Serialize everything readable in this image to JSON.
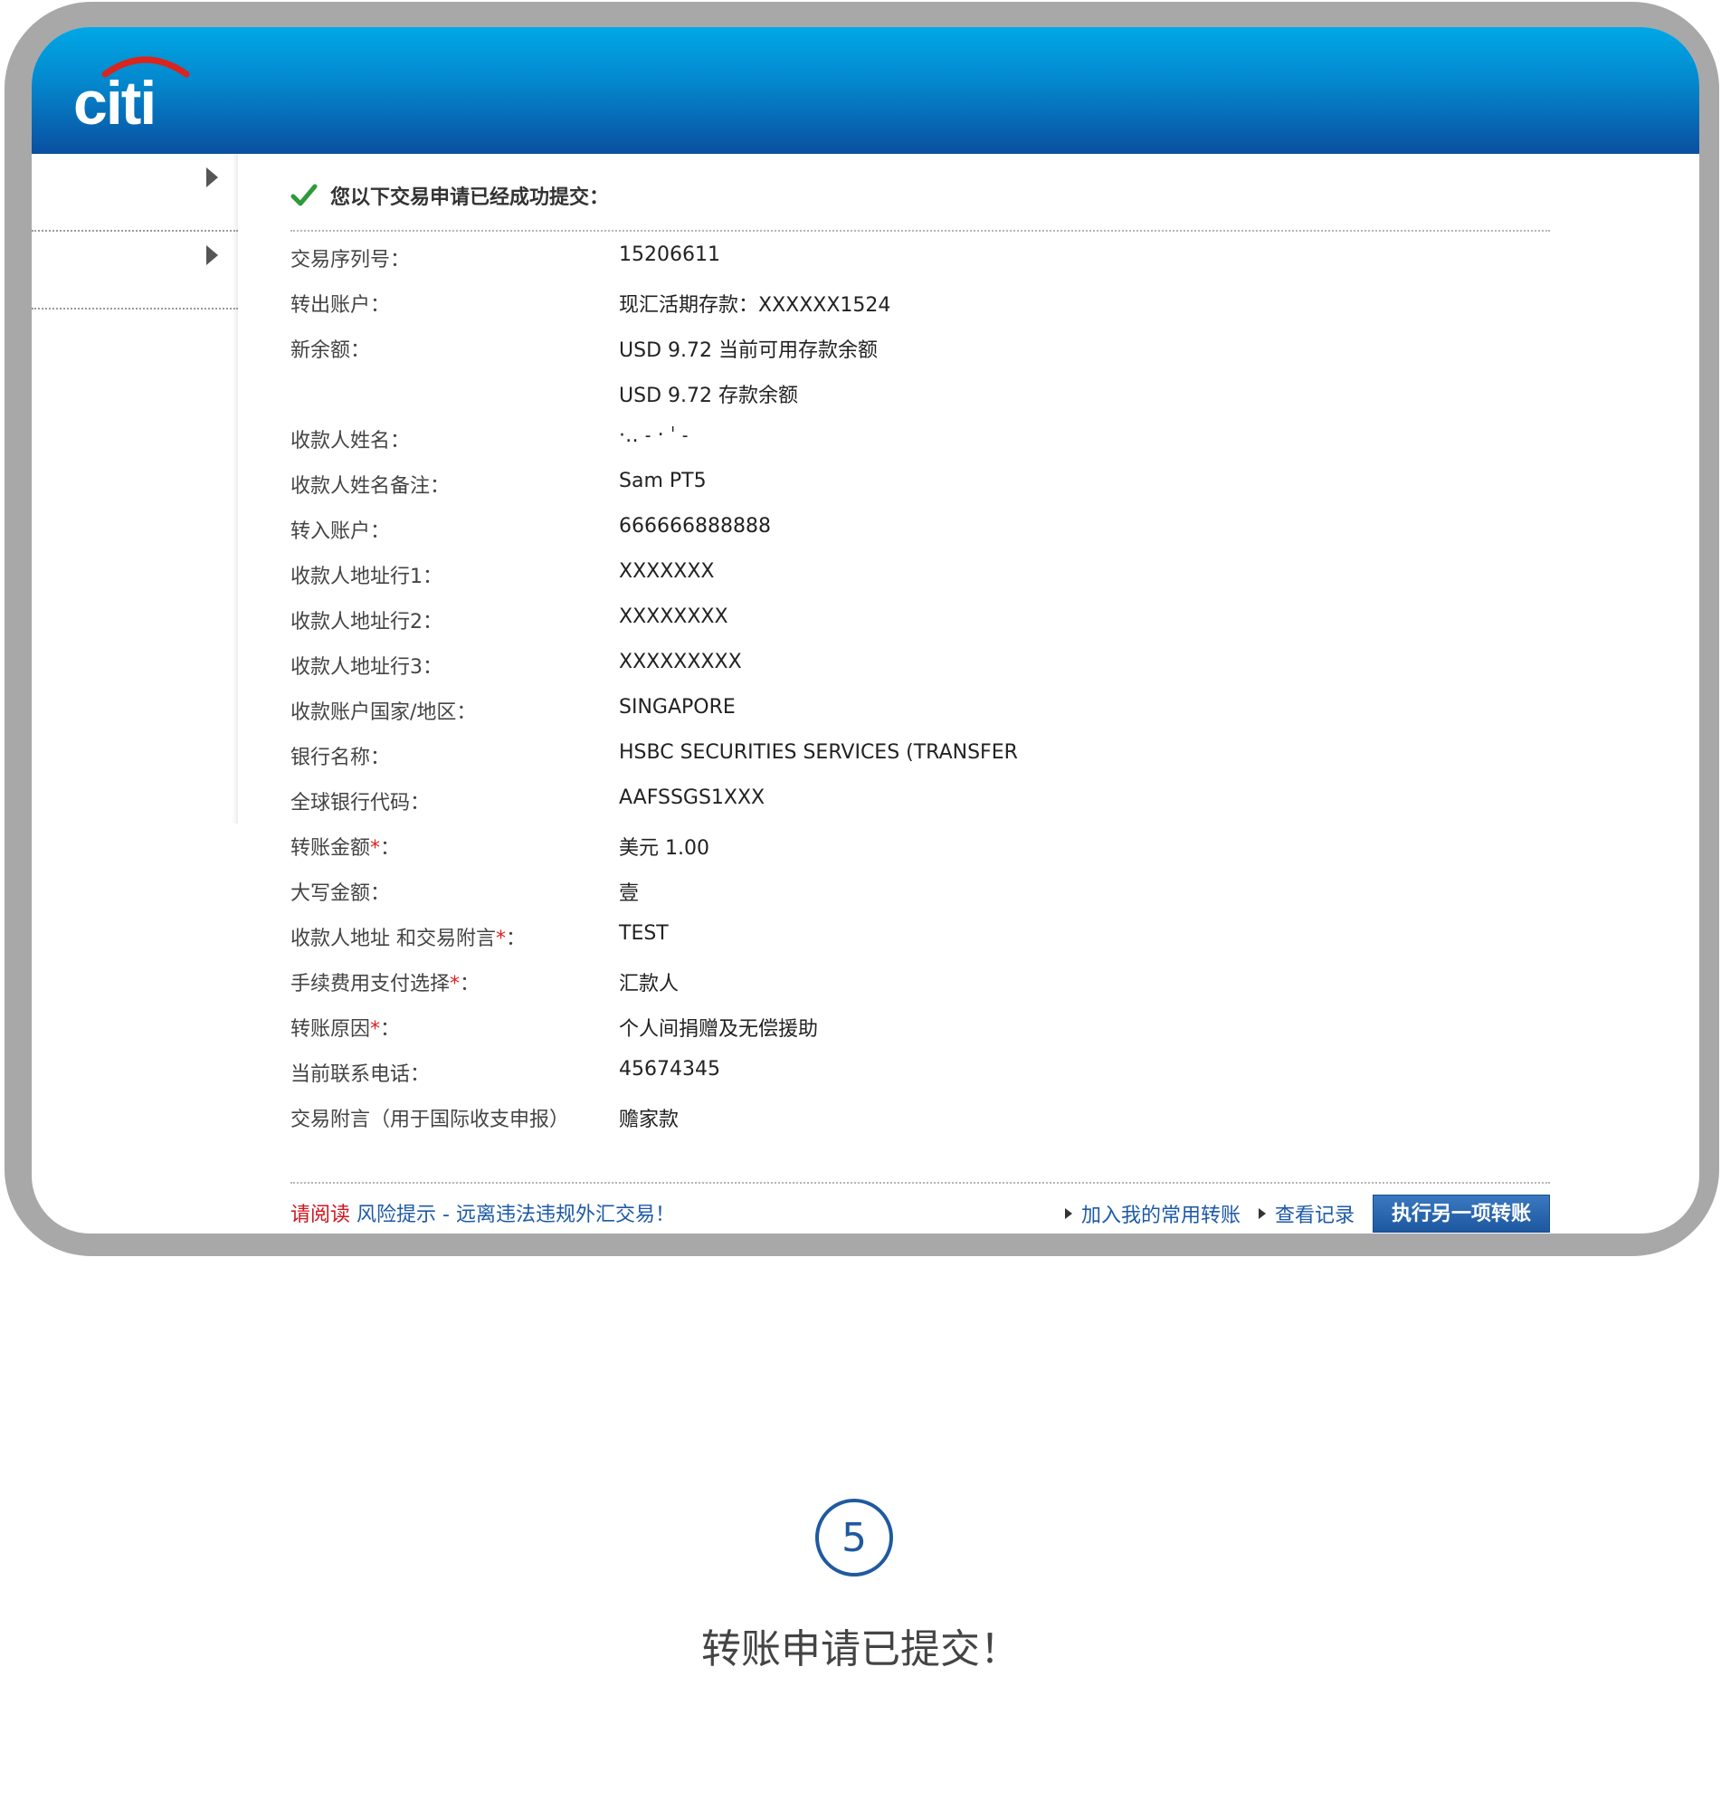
{
  "brand": {
    "logo_text": "citi",
    "arc_color": "#d9251d",
    "header_color": "#0a4fa0"
  },
  "sidebar": {
    "items": [
      {
        "icon": "arrow-right-icon"
      },
      {
        "icon": "arrow-right-icon"
      }
    ]
  },
  "confirmation": {
    "message": "您以下交易申请已经成功提交：",
    "icon": "check-icon"
  },
  "details": {
    "serial_label": "交易序列号：",
    "serial_value": "15206611",
    "from_label": "转出账户：",
    "from_value": "现汇活期存款：XXXXXX1524",
    "balance_label": "新余额：",
    "balance_available": "USD 9.72 当前可用存款余额",
    "balance_deposit": "USD 9.72 存款余额",
    "payee_name_label": "收款人姓名：",
    "payee_name_value": "·‥ ˗ ‧ ˈ ˗",
    "payee_note_label": "收款人姓名备注：",
    "payee_note_value": "Sam PT5",
    "to_account_label": "转入账户：",
    "to_account_value": "666666888888",
    "addr1_label": "收款人地址行1：",
    "addr1_value": "XXXXXXX",
    "addr2_label": "收款人地址行2：",
    "addr2_value": "XXXXXXXX",
    "addr3_label": "收款人地址行3：",
    "addr3_value": "XXXXXXXXX",
    "country_label": "收款账户国家/地区：",
    "country_value": "SINGAPORE",
    "bank_label": "银行名称：",
    "bank_value": "HSBC SECURITIES SERVICES (TRANSFER",
    "swift_label": "全球银行代码：",
    "swift_value": "AAFSSGS1XXX",
    "amount_label": "转账金额",
    "amount_value": "美元 1.00",
    "amount_words_label": "大写金额：",
    "amount_words_value": "壹",
    "message_label": "收款人地址 和交易附言",
    "message_value": "TEST",
    "fee_label": "手续费用支付选择",
    "fee_value": "汇款人",
    "reason_label": "转账原因",
    "reason_value": "个人间捐赠及无偿援助",
    "phone_label": "当前联系电话：",
    "phone_value": "45674345",
    "remark_label": "交易附言（用于国际收支申报）",
    "remark_value": "赡家款",
    "required_mark": "*",
    "colon": "："
  },
  "footer": {
    "read_label": "请阅读",
    "risk_link": "风险提示 - 远离违法违规外汇交易！",
    "add_favorite": "加入我的常用转账",
    "view_records": "查看记录",
    "another_transfer": "执行另一项转账"
  },
  "step": {
    "number": "5",
    "caption": "转账申请已提交！"
  }
}
